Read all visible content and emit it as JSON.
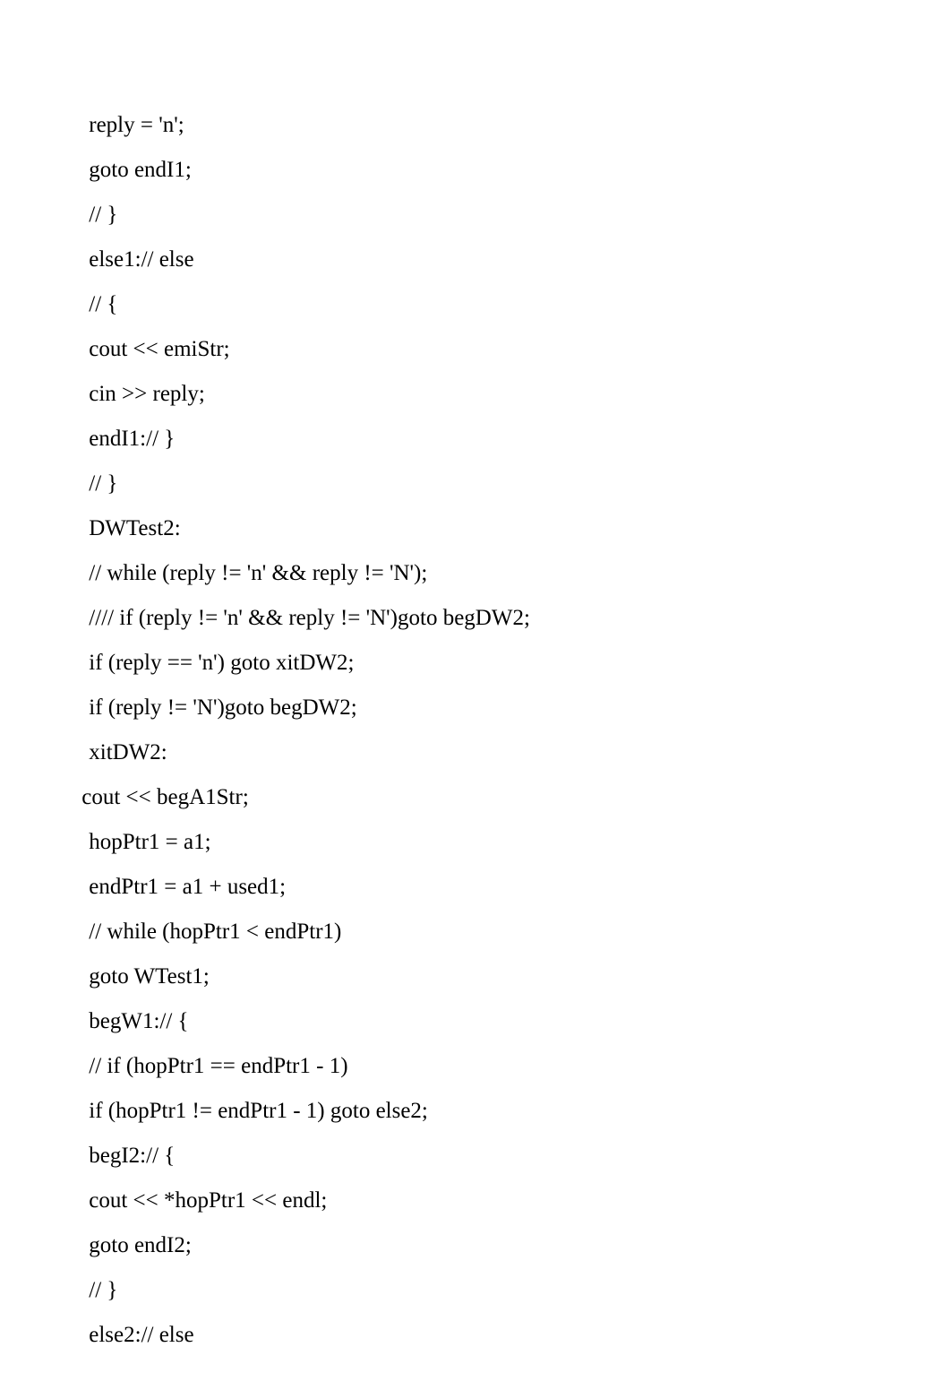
{
  "lines": [
    {
      "text": " reply = 'n';",
      "outdent": false
    },
    {
      "text": " goto endI1;",
      "outdent": false
    },
    {
      "text": " // }",
      "outdent": false
    },
    {
      "text": " else1:// else",
      "outdent": false
    },
    {
      "text": " // {",
      "outdent": false
    },
    {
      "text": " cout << emiStr;",
      "outdent": false
    },
    {
      "text": " cin >> reply;",
      "outdent": false
    },
    {
      "text": " endI1:// }",
      "outdent": false
    },
    {
      "text": " // }",
      "outdent": false
    },
    {
      "text": " DWTest2:",
      "outdent": false
    },
    {
      "text": " // while (reply != 'n' && reply != 'N');",
      "outdent": false
    },
    {
      "text": " //// if (reply != 'n' && reply != 'N')goto begDW2;",
      "outdent": false
    },
    {
      "text": " if (reply == 'n') goto xitDW2;",
      "outdent": false
    },
    {
      "text": " if (reply != 'N')goto begDW2;",
      "outdent": false
    },
    {
      "text": " xitDW2:",
      "outdent": false
    },
    {
      "text": " cout << begA1Str;",
      "outdent": true
    },
    {
      "text": " hopPtr1 = a1;",
      "outdent": false
    },
    {
      "text": " endPtr1 = a1 + used1;",
      "outdent": false
    },
    {
      "text": " // while (hopPtr1 < endPtr1)",
      "outdent": false
    },
    {
      "text": " goto WTest1;",
      "outdent": false
    },
    {
      "text": " begW1:// {",
      "outdent": false
    },
    {
      "text": " // if (hopPtr1 == endPtr1 - 1)",
      "outdent": false
    },
    {
      "text": " if (hopPtr1 != endPtr1 - 1) goto else2;",
      "outdent": false
    },
    {
      "text": " begI2:// {",
      "outdent": false
    },
    {
      "text": " cout << *hopPtr1 << endl;",
      "outdent": false
    },
    {
      "text": " goto endI2;",
      "outdent": false
    },
    {
      "text": " // }",
      "outdent": false
    },
    {
      "text": " else2:// else",
      "outdent": false
    }
  ]
}
